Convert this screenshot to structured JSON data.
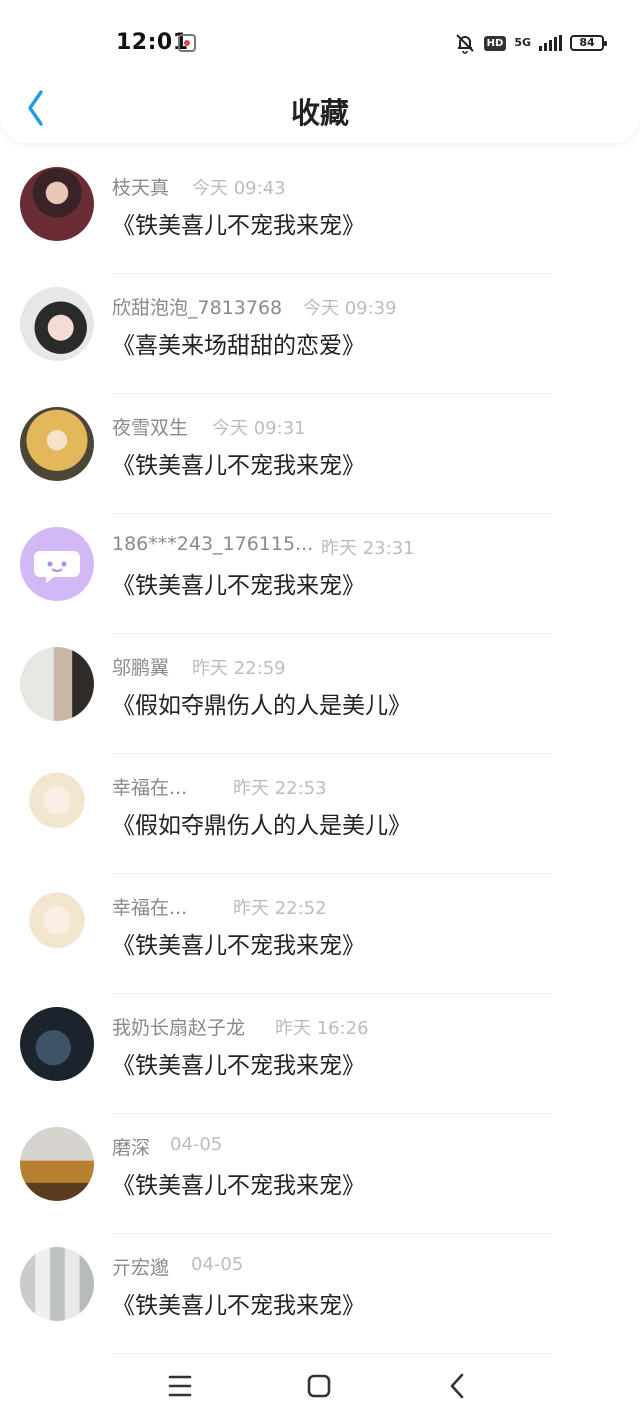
{
  "status_bar": {
    "time": "12:01",
    "network": "5G",
    "hd": "HD",
    "battery": "84"
  },
  "header": {
    "title": "收藏"
  },
  "favorites": [
    {
      "user": "枝天真",
      "time": "今天 09:43",
      "title": "《铁美喜儿不宠我来宠》"
    },
    {
      "user": "欣甜泡泡_7813768",
      "time": "今天 09:39",
      "title": "《喜美来场甜甜的恋爱》"
    },
    {
      "user": "夜雪双生",
      "time": "今天 09:31",
      "title": "《铁美喜儿不宠我来宠》"
    },
    {
      "user": "186***243_176115...",
      "time": "昨天 23:31",
      "title": "《铁美喜儿不宠我来宠》"
    },
    {
      "user": "邬鹏翼",
      "time": "昨天 22:59",
      "title": "《假如夺鼎伤人的人是美儿》"
    },
    {
      "user": "幸福在...",
      "time": "昨天 22:53",
      "title": "《假如夺鼎伤人的人是美儿》"
    },
    {
      "user": "幸福在...",
      "time": "昨天 22:52",
      "title": "《铁美喜儿不宠我来宠》"
    },
    {
      "user": "我奶长扇赵子龙",
      "time": "昨天 16:26",
      "title": "《铁美喜儿不宠我来宠》"
    },
    {
      "user": "磨深",
      "time": "04-05",
      "title": "《铁美喜儿不宠我来宠》"
    },
    {
      "user": "亓宏邈",
      "time": "04-05",
      "title": "《铁美喜儿不宠我来宠》"
    }
  ],
  "icons": {
    "back": "chevron-left-icon",
    "menu": "menu-icon",
    "home": "home-icon",
    "nav_back": "back-icon"
  },
  "colors": {
    "accent": "#1e9bf0",
    "name_gray": "#8a8a8a",
    "time_gray": "#bdbdbd"
  }
}
